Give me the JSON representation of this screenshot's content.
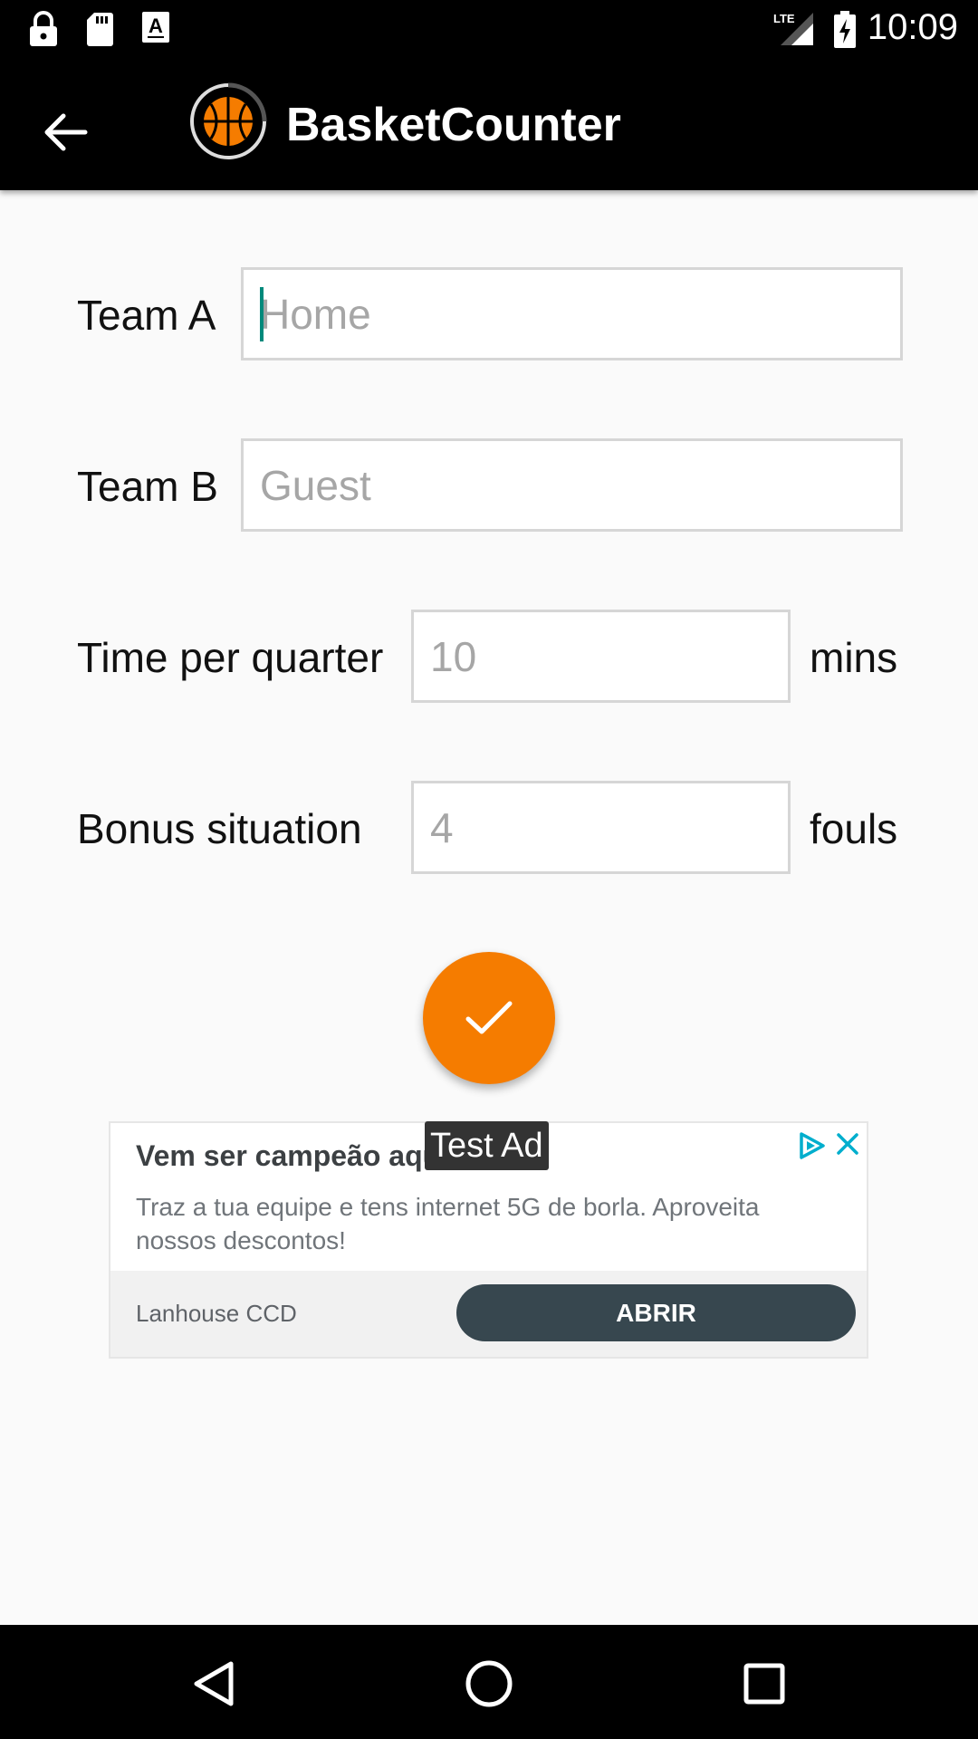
{
  "status_bar": {
    "time": "10:09",
    "icons": [
      "lock-icon",
      "sd-card-icon",
      "text-a-icon",
      "lte-signal-icon",
      "battery-charging-icon"
    ]
  },
  "app_bar": {
    "title": "BasketCounter",
    "back_icon": "arrow-left-icon",
    "logo_icon": "basketball-logo-icon"
  },
  "form": {
    "team_a": {
      "label": "Team A",
      "value": "",
      "placeholder": "Home"
    },
    "team_b": {
      "label": "Team B",
      "value": "",
      "placeholder": "Guest"
    },
    "time_per_quarter": {
      "label": "Time per quarter",
      "value": "",
      "placeholder": "10",
      "unit": "mins"
    },
    "bonus_situation": {
      "label": "Bonus situation",
      "value": "",
      "placeholder": "4",
      "unit": "fouls"
    }
  },
  "confirm_button": {
    "icon": "checkmark-icon",
    "color": "#f57c00"
  },
  "ad": {
    "badge": "Test Ad",
    "headline": "Vem ser campeão aqui",
    "body": "Traz a tua equipe e tens internet 5G de borla. Aproveita nossos descontos!",
    "advertiser": "Lanhouse CCD",
    "cta": "ABRIR",
    "cta_color": "#37474f"
  },
  "nav_bar": {
    "icons": [
      "back-triangle-icon",
      "home-circle-icon",
      "recents-square-icon"
    ]
  }
}
